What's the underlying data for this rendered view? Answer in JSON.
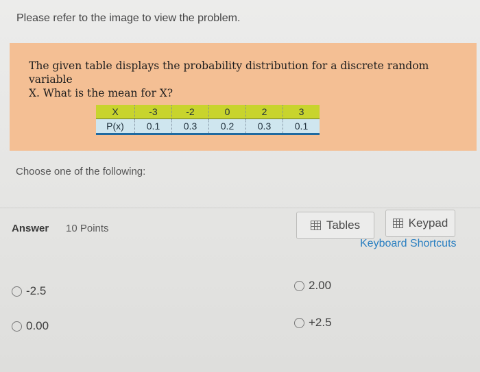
{
  "instruction": "Please refer to the image to view the problem.",
  "problem": {
    "question_line1": "The given table displays the probability distribution for a discrete random variable",
    "question_line2": "X. What is the mean for X?",
    "table": {
      "row1": [
        "X",
        "-3",
        "-2",
        "0",
        "2",
        "3"
      ],
      "row2": [
        "P(x)",
        "0.1",
        "0.3",
        "0.2",
        "0.3",
        "0.1"
      ]
    },
    "colors": {
      "card": "#f4bf94",
      "header_row": "#c8d42d",
      "value_row": "#cfe6ef"
    }
  },
  "choose_text": "Choose one of the following:",
  "answer": {
    "label": "Answer",
    "points": "10 Points"
  },
  "tools": {
    "tables_label": "Tables",
    "tables_icon": "table-icon",
    "keypad_label": "Keypad",
    "keypad_icon": "keypad-icon",
    "shortcuts_label": "Keyboard Shortcuts"
  },
  "options": [
    "-2.5",
    "2.00",
    "0.00",
    "+2.5"
  ]
}
